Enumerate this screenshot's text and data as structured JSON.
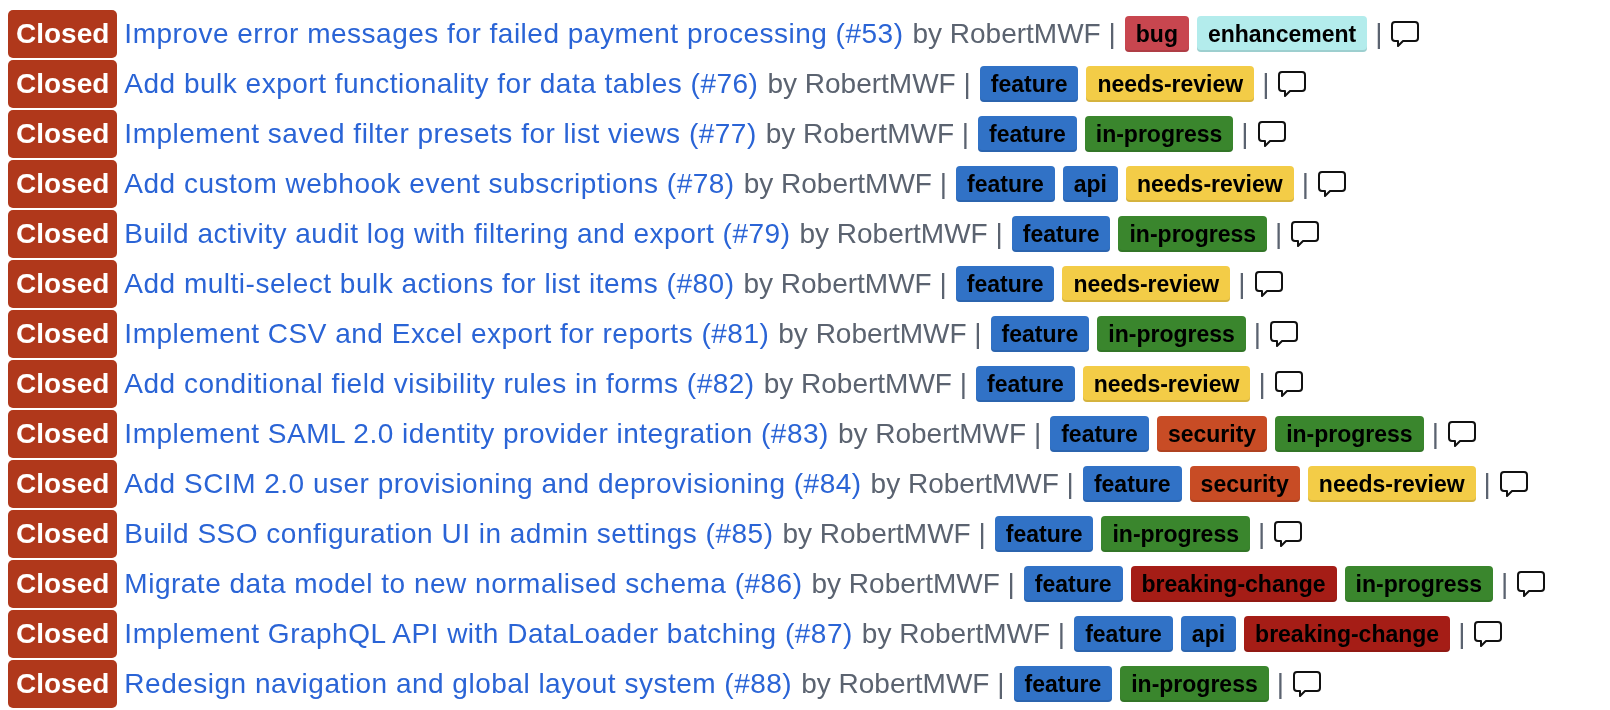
{
  "issues": [
    {
      "status": "Closed",
      "title": "Improve error messages for failed payment processing (#53)",
      "byline": "by RobertMWF |",
      "labels": [
        {
          "name": "bug",
          "color": "#c8464f"
        },
        {
          "name": "enhancement",
          "color": "#b3ecec"
        }
      ],
      "separator": "|"
    },
    {
      "status": "Closed",
      "title": "Add bulk export functionality for data tables (#76)",
      "byline": "by RobertMWF |",
      "labels": [
        {
          "name": "feature",
          "color": "#3172c6"
        },
        {
          "name": "needs-review",
          "color": "#f3cc47"
        }
      ],
      "separator": "|"
    },
    {
      "status": "Closed",
      "title": "Implement saved filter presets for list views (#77)",
      "byline": "by RobertMWF |",
      "labels": [
        {
          "name": "feature",
          "color": "#3172c6"
        },
        {
          "name": "in-progress",
          "color": "#3a862d"
        }
      ],
      "separator": "|"
    },
    {
      "status": "Closed",
      "title": "Add custom webhook event subscriptions (#78)",
      "byline": "by RobertMWF |",
      "labels": [
        {
          "name": "feature",
          "color": "#3172c6"
        },
        {
          "name": "api",
          "color": "#3172c6"
        },
        {
          "name": "needs-review",
          "color": "#f3cc47"
        }
      ],
      "separator": "|"
    },
    {
      "status": "Closed",
      "title": "Build activity audit log with filtering and export (#79)",
      "byline": "by RobertMWF |",
      "labels": [
        {
          "name": "feature",
          "color": "#3172c6"
        },
        {
          "name": "in-progress",
          "color": "#3a862d"
        }
      ],
      "separator": "|"
    },
    {
      "status": "Closed",
      "title": "Add multi-select bulk actions for list items (#80)",
      "byline": "by RobertMWF |",
      "labels": [
        {
          "name": "feature",
          "color": "#3172c6"
        },
        {
          "name": "needs-review",
          "color": "#f3cc47"
        }
      ],
      "separator": "|"
    },
    {
      "status": "Closed",
      "title": "Implement CSV and Excel export for reports (#81)",
      "byline": "by RobertMWF |",
      "labels": [
        {
          "name": "feature",
          "color": "#3172c6"
        },
        {
          "name": "in-progress",
          "color": "#3a862d"
        }
      ],
      "separator": "|"
    },
    {
      "status": "Closed",
      "title": "Add conditional field visibility rules in forms (#82)",
      "byline": "by RobertMWF |",
      "labels": [
        {
          "name": "feature",
          "color": "#3172c6"
        },
        {
          "name": "needs-review",
          "color": "#f3cc47"
        }
      ],
      "separator": "|"
    },
    {
      "status": "Closed",
      "title": "Implement SAML 2.0 identity provider integration (#83)",
      "byline": "by RobertMWF |",
      "labels": [
        {
          "name": "feature",
          "color": "#3172c6"
        },
        {
          "name": "security",
          "color": "#c84c25"
        },
        {
          "name": "in-progress",
          "color": "#3a862d"
        }
      ],
      "separator": "|"
    },
    {
      "status": "Closed",
      "title": "Add SCIM 2.0 user provisioning and deprovisioning (#84)",
      "byline": "by RobertMWF |",
      "labels": [
        {
          "name": "feature",
          "color": "#3172c6"
        },
        {
          "name": "security",
          "color": "#c84c25"
        },
        {
          "name": "needs-review",
          "color": "#f3cc47"
        }
      ],
      "separator": "|"
    },
    {
      "status": "Closed",
      "title": "Build SSO configuration UI in admin settings (#85)",
      "byline": "by RobertMWF |",
      "labels": [
        {
          "name": "feature",
          "color": "#3172c6"
        },
        {
          "name": "in-progress",
          "color": "#3a862d"
        }
      ],
      "separator": "|"
    },
    {
      "status": "Closed",
      "title": "Migrate data model to new normalised schema (#86)",
      "byline": "by RobertMWF |",
      "labels": [
        {
          "name": "feature",
          "color": "#3172c6"
        },
        {
          "name": "breaking-change",
          "color": "#a51d16"
        },
        {
          "name": "in-progress",
          "color": "#3a862d"
        }
      ],
      "separator": "|"
    },
    {
      "status": "Closed",
      "title": "Implement GraphQL API with DataLoader batching (#87)",
      "byline": "by RobertMWF |",
      "labels": [
        {
          "name": "feature",
          "color": "#3172c6"
        },
        {
          "name": "api",
          "color": "#3172c6"
        },
        {
          "name": "breaking-change",
          "color": "#a51d16"
        }
      ],
      "separator": "|"
    },
    {
      "status": "Closed",
      "title": "Redesign navigation and global layout system (#88)",
      "byline": "by RobertMWF |",
      "labels": [
        {
          "name": "feature",
          "color": "#3172c6"
        },
        {
          "name": "in-progress",
          "color": "#3a862d"
        }
      ],
      "separator": "|"
    }
  ]
}
